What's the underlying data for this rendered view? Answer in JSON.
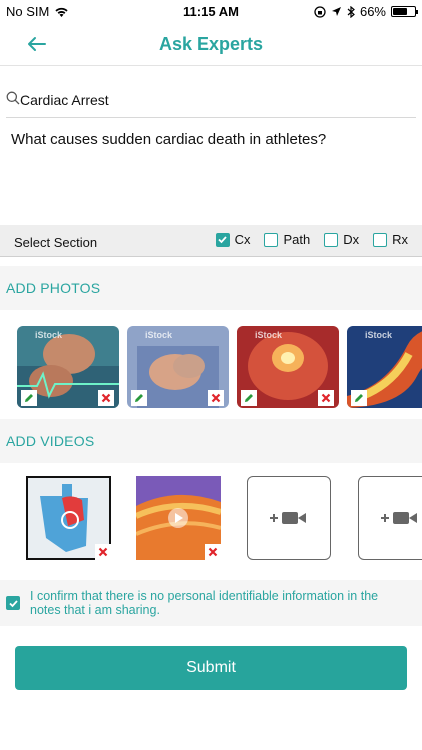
{
  "status_bar": {
    "carrier": "No SIM",
    "time": "11:15 AM",
    "battery": "66%",
    "battery_level": 0.66
  },
  "header": {
    "title": "Ask Experts"
  },
  "search": {
    "value": "Cardiac Arrest"
  },
  "question": "What causes sudden cardiac death in athletes?",
  "section_selector": {
    "label": "Select Section",
    "options": [
      {
        "label": "Cx",
        "checked": true
      },
      {
        "label": "Path",
        "checked": false
      },
      {
        "label": "Dx",
        "checked": false
      },
      {
        "label": "Rx",
        "checked": false
      }
    ]
  },
  "photos": {
    "heading": "ADD PHOTOS",
    "items": [
      {
        "watermark": "iStock",
        "description": "person-clutching-chest"
      },
      {
        "watermark": "iStock",
        "description": "hands-on-chest"
      },
      {
        "watermark": "iStock",
        "description": "heart-xray"
      },
      {
        "watermark": "iStock",
        "description": "artery-illustration"
      }
    ]
  },
  "videos": {
    "heading": "ADD VIDEOS",
    "items": [
      {
        "description": "heart-diagram-thumbnail"
      },
      {
        "description": "colorful-artery-thumbnail"
      }
    ],
    "add_slots": 2
  },
  "confirm": {
    "checked": true,
    "text": "I confirm that there is no personal identifiable information in the notes that i am sharing."
  },
  "submit": {
    "label": "Submit"
  },
  "colors": {
    "accent": "#2aa5a0",
    "button": "#27a49c",
    "delete": "#e0242b",
    "edit": "#2a9a3c"
  }
}
